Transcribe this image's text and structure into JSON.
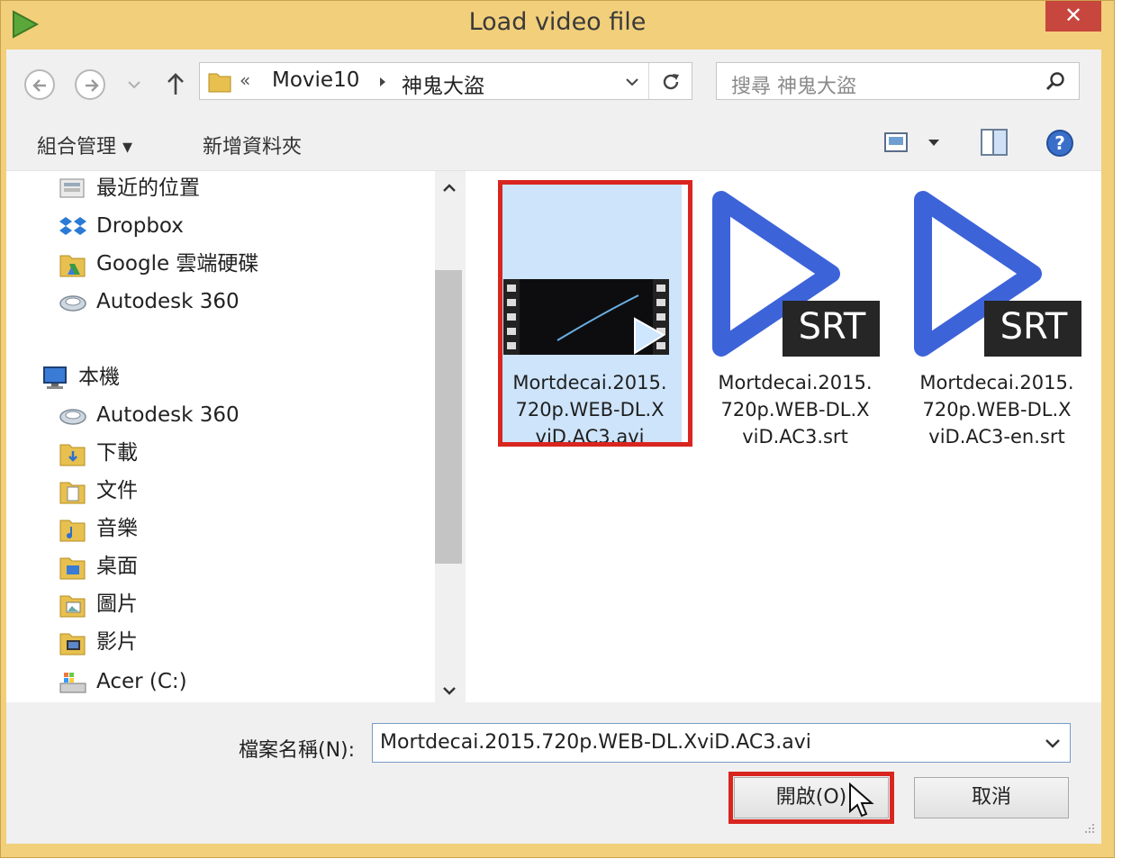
{
  "window": {
    "title": "Load video file",
    "close_label": "✕"
  },
  "address": {
    "prefix": "«",
    "crumbs": [
      "Movie10",
      "神鬼大盜"
    ]
  },
  "search": {
    "placeholder": "搜尋 神鬼大盜"
  },
  "toolbar": {
    "organize": "組合管理 ▾",
    "new_folder": "新增資料夾"
  },
  "nav": {
    "items": [
      {
        "label": "最近的位置",
        "icon": "recent-places-icon"
      },
      {
        "label": "Dropbox",
        "icon": "dropbox-icon"
      },
      {
        "label": "Google 雲端硬碟",
        "icon": "google-drive-icon"
      },
      {
        "label": "Autodesk 360",
        "icon": "autodesk-icon"
      },
      {
        "label": "本機",
        "icon": "computer-icon"
      },
      {
        "label": "Autodesk 360",
        "icon": "autodesk-icon"
      },
      {
        "label": "下載",
        "icon": "downloads-folder-icon"
      },
      {
        "label": "文件",
        "icon": "documents-folder-icon"
      },
      {
        "label": "音樂",
        "icon": "music-folder-icon"
      },
      {
        "label": "桌面",
        "icon": "desktop-folder-icon"
      },
      {
        "label": "圖片",
        "icon": "pictures-folder-icon"
      },
      {
        "label": "影片",
        "icon": "videos-folder-icon"
      },
      {
        "label": "Acer (C:)",
        "icon": "drive-icon"
      }
    ]
  },
  "files": [
    {
      "name": "Mortdecai.2015.720p.WEB-DL.XviD.AC3.avi",
      "line1": "Mortdecai.2015.",
      "line2": "720p.WEB-DL.X",
      "line3": "viD.AC3.avi",
      "type": "video",
      "selected": true
    },
    {
      "name": "Mortdecai.2015.720p.WEB-DL.XviD.AC3.srt",
      "line1": "Mortdecai.2015.",
      "line2": "720p.WEB-DL.X",
      "line3": "viD.AC3.srt",
      "type": "srt",
      "badge": "SRT"
    },
    {
      "name": "Mortdecai.2015.720p.WEB-DL.XviD.AC3-en.srt",
      "line1": "Mortdecai.2015.",
      "line2": "720p.WEB-DL.X",
      "line3": "viD.AC3-en.srt",
      "type": "srt",
      "badge": "SRT"
    }
  ],
  "bottom": {
    "filename_label": "檔案名稱(N):",
    "filename_value": "Mortdecai.2015.720p.WEB-DL.XviD.AC3.avi",
    "open_label": "開啟(O)",
    "cancel_label": "取消"
  },
  "colors": {
    "frame": "#f2cf7a",
    "highlight": "#d9251f",
    "selection": "#cde4fb",
    "play_blue": "#3d63d9"
  }
}
